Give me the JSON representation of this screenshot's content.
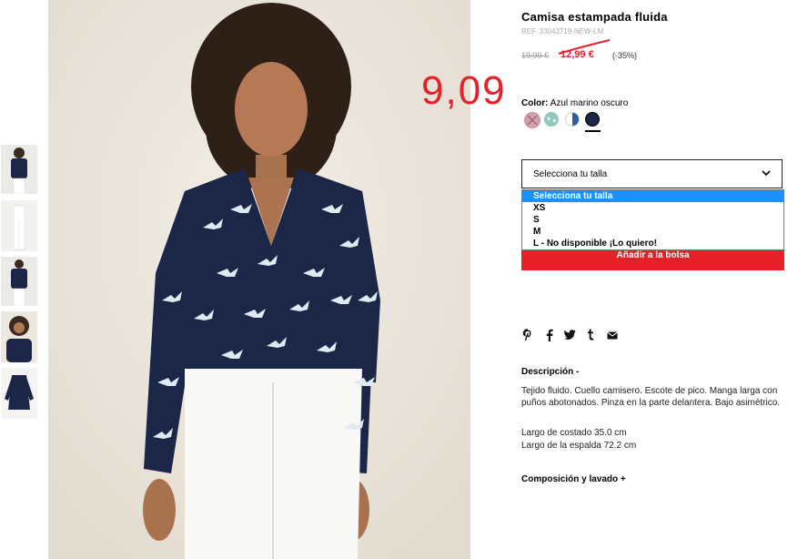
{
  "product": {
    "title": "Camisa estampada fluida",
    "ref": "REF. 33043719-NEW-LM",
    "old_price": "19,99 €",
    "sale_price": "12,99 €",
    "discount": "(-35%)",
    "handwritten_price": "9,09"
  },
  "color": {
    "label": "Color:",
    "value": "Azul marino oscuro",
    "swatches": [
      {
        "name": "rosa",
        "hex": "#d4a0ab"
      },
      {
        "name": "estampado verde",
        "hex": "#8fc9bd"
      },
      {
        "name": "azul blanco",
        "hex": "#2b5aa6"
      },
      {
        "name": "azul marino oscuro",
        "hex": "#1c2747"
      }
    ],
    "selected_index": 3
  },
  "size_select": {
    "value": "Selecciona tu talla",
    "options": [
      "Selecciona tu talla",
      "XS",
      "S",
      "M",
      "L - No disponible ¡Lo quiero!"
    ]
  },
  "add_to_bag": "Añadir a la bolsa",
  "share_icons": [
    "pinterest-icon",
    "facebook-icon",
    "twitter-icon",
    "tumblr-icon",
    "email-icon"
  ],
  "description": {
    "title": "Descripción  -",
    "text": "Tejido fluido. Cuello camisero. Escote de pico. Manga larga con puños abotonados. Pinza en la parte delantera. Bajo asimétrico.",
    "side_length": "Largo de costado 35.0 cm",
    "back_length": "Largo de la espalda 72.2 cm"
  },
  "composition_title": "Composición y lavado  +",
  "colors": {
    "accent": "#e8202a",
    "navy": "#1c2747",
    "selected_option": "#1e90ff"
  }
}
